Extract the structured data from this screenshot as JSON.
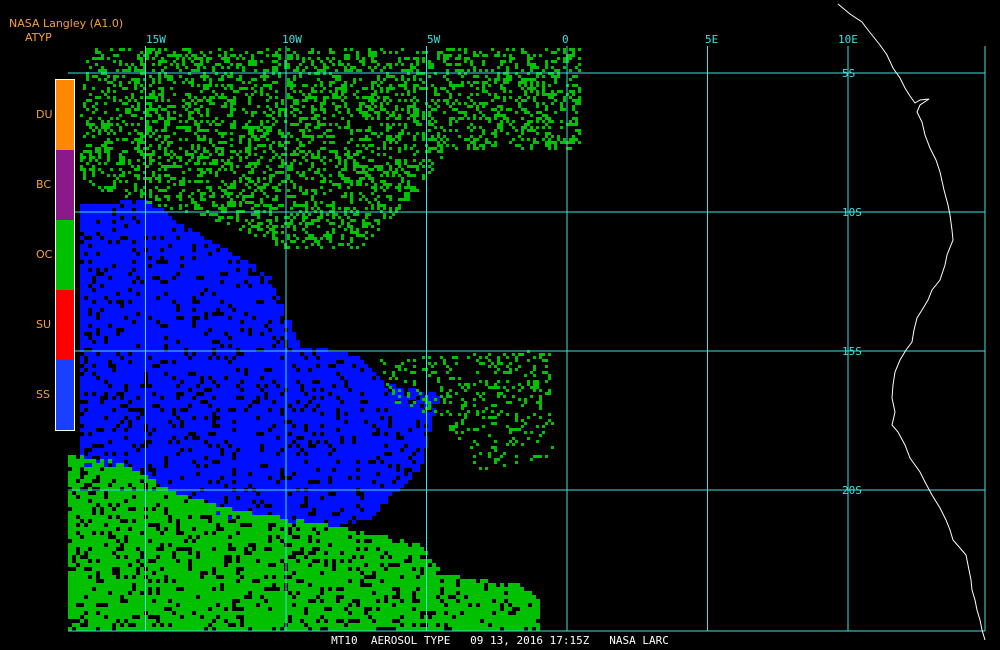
{
  "header": {
    "source": "NASA Langley (A1.0)",
    "product": "ATYP"
  },
  "legend": [
    {
      "label": "DU",
      "color": "#ff8800"
    },
    {
      "label": "BC",
      "color": "#8a1a8a"
    },
    {
      "label": "OC",
      "color": "#00c000"
    },
    {
      "label": "SU",
      "color": "#ff0000"
    },
    {
      "label": "SS",
      "color": "#1a40ff"
    }
  ],
  "map": {
    "lon_ticks": [
      {
        "label": "15W",
        "lon": -15
      },
      {
        "label": "10W",
        "lon": -10
      },
      {
        "label": "5W",
        "lon": -5
      },
      {
        "label": "0",
        "lon": 0
      },
      {
        "label": "5E",
        "lon": 5
      },
      {
        "label": "10E",
        "lon": 10
      }
    ],
    "lat_ticks": [
      {
        "label": "5S",
        "lat": -5
      },
      {
        "label": "10S",
        "lat": -10
      },
      {
        "label": "15S",
        "lat": -15
      },
      {
        "label": "20S",
        "lat": -20
      }
    ],
    "grid_color": "#40e0e0",
    "coast_color": "#ffffff",
    "blue_color": "#0010ff",
    "green_color": "#00c000"
  },
  "footer": {
    "text": "MT10  AEROSOL TYPE   09 13, 2016 17:15Z   NASA LARC"
  }
}
